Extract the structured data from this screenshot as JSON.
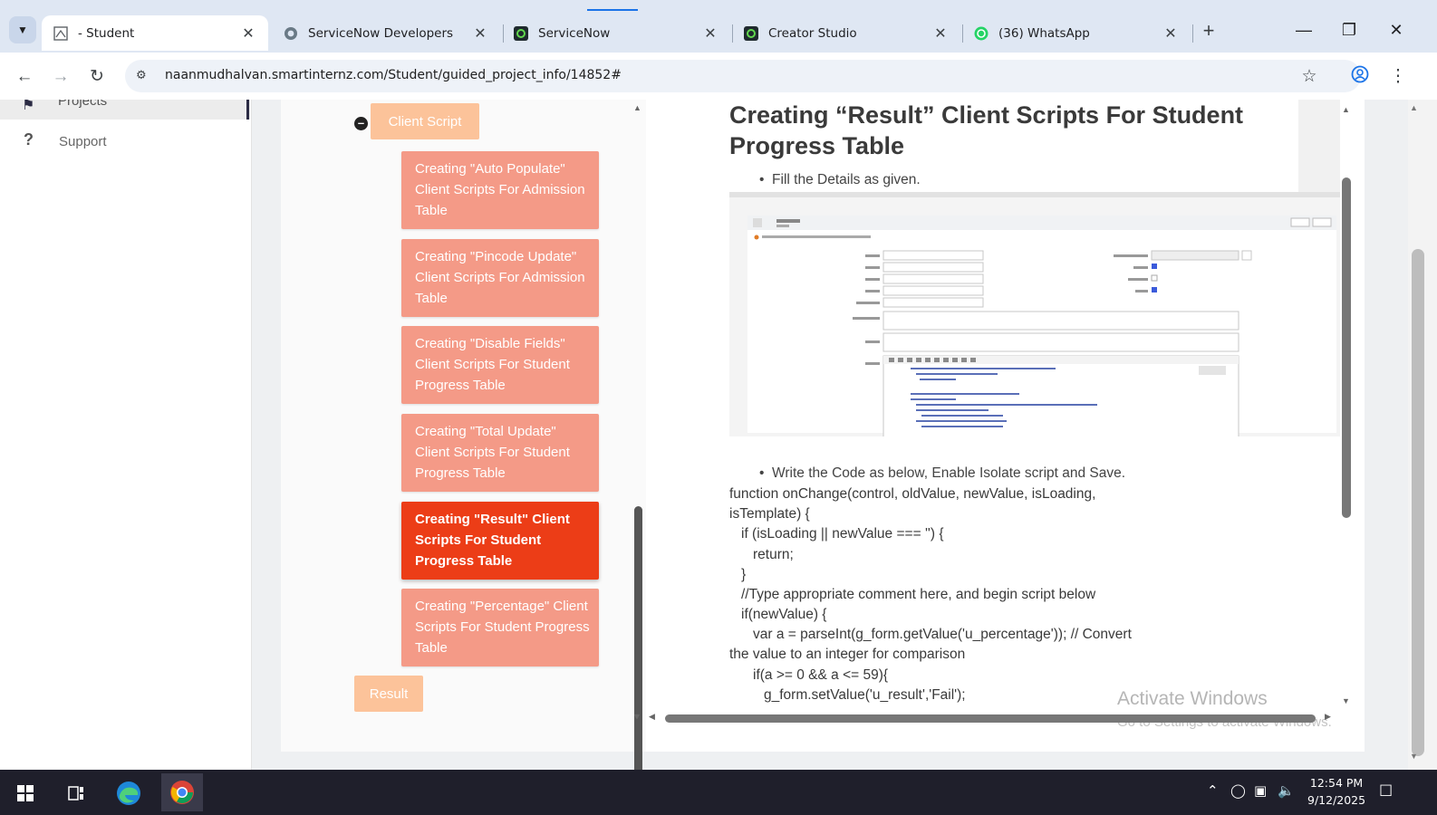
{
  "browser": {
    "tabs": [
      {
        "label": " - Student"
      },
      {
        "label": "ServiceNow Developers"
      },
      {
        "label": "ServiceNow"
      },
      {
        "label": "Creator Studio"
      },
      {
        "label": "(36) WhatsApp"
      }
    ],
    "url": "naanmudhalvan.smartinternz.com/Student/guided_project_info/14852#"
  },
  "sidebar": {
    "projects_label": "Projects",
    "support_label": "Support"
  },
  "tree": {
    "section_label": "Client Script",
    "topics": [
      {
        "label": "Creating \"Auto Populate\" Client Scripts For Admission Table"
      },
      {
        "label": "Creating \"Pincode Update\" Client Scripts For Admission Table"
      },
      {
        "label": "Creating \"Disable Fields\" Client Scripts For Student Progress Table"
      },
      {
        "label": "Creating \"Total Update\" Client Scripts For Student Progress Table"
      },
      {
        "label": "Creating \"Result\" Client Scripts For Student Progress Table"
      },
      {
        "label": "Creating \"Percentage\" Client Scripts For Student Progress Table"
      }
    ],
    "active_index": 4,
    "result_label": "Result"
  },
  "article": {
    "title": "Creating “Result” Client Scripts For Student Progress Table",
    "bullet1": "Fill the Details as given.",
    "bullet2": "Write the Code as below, Enable Isolate script and Save.",
    "code_lines": [
      "function onChange(control, oldValue, newValue, isLoading,",
      "isTemplate) {",
      "   if (isLoading || newValue === '') {",
      "      return;",
      "   }",
      "   //Type appropriate comment here, and begin script below",
      "   if(newValue) {",
      "      var a = parseInt(g_form.getValue('u_percentage')); // Convert",
      "the value to an integer for comparison",
      "      if(a >= 0 && a <= 59){",
      "         g_form.setValue('u_result','Fail');"
    ]
  },
  "watermark": {
    "line1": "Activate Windows",
    "line2": "Go to Settings to activate Windows."
  },
  "taskbar": {
    "time": "12:54 PM",
    "date": "9/12/2025"
  },
  "colors": {
    "topic_inactive": "#f49a87",
    "topic_active": "#ec3d17",
    "section_button": "#fcc39a"
  }
}
